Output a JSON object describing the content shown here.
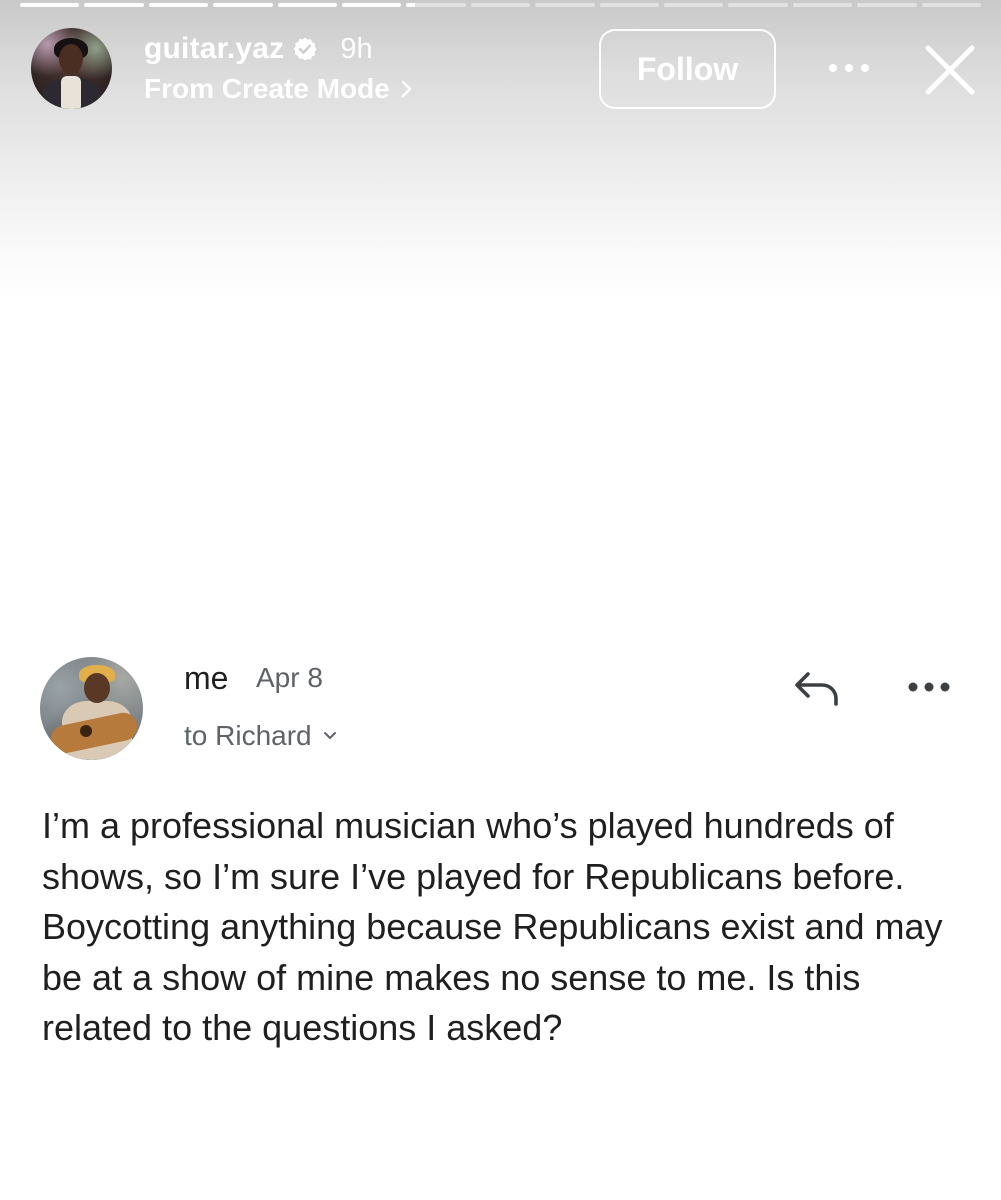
{
  "story": {
    "segments_total": 15,
    "segments_complete": 6,
    "current_segment_progress": 0.15,
    "username": "guitar.yaz",
    "verified": true,
    "time_ago": "9h",
    "subtitle": "From Create Mode",
    "follow_label": "Follow",
    "icons": {
      "avatar": "profile-avatar",
      "verified": "verified-badge-icon",
      "more": "more-options-icon",
      "close": "close-icon",
      "subtitle_chevron": "chevron-right-icon"
    }
  },
  "email": {
    "sender": "me",
    "date": "Apr 8",
    "recipient": "to Richard",
    "icons": {
      "reply": "reply-icon",
      "more": "more-options-icon",
      "recipient_chevron": "chevron-down-icon"
    },
    "body": "I’m a professional musician who’s played hundreds of shows, so I’m sure I’ve played for Republicans before. Boycotting anything because Republicans exist and may be at a show of mine makes no sense to me. Is this related to the questions I asked?"
  },
  "colors": {
    "text_primary": "#1f1f1f",
    "text_secondary": "#5f6368",
    "overlay_text": "#ffffff"
  }
}
